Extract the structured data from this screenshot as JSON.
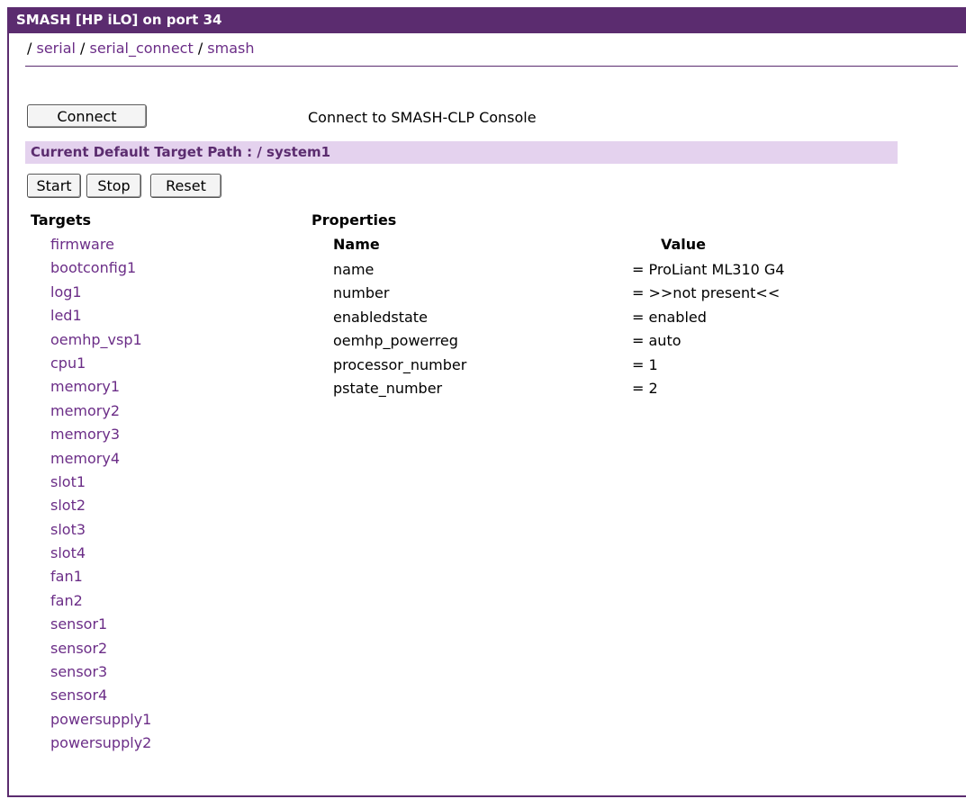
{
  "window": {
    "title": "SMASH [HP iLO] on port 34"
  },
  "breadcrumb": {
    "lead_sep": "/",
    "items": [
      "serial",
      "serial_connect",
      "smash"
    ],
    "sep": " / "
  },
  "connect": {
    "button_label": "Connect",
    "description": "Connect to SMASH-CLP Console"
  },
  "target_path": {
    "text": "Current Default Target Path : / system1"
  },
  "actions": {
    "start": "Start",
    "stop": "Stop",
    "reset": "Reset"
  },
  "targets": {
    "heading": "Targets",
    "items": [
      "firmware",
      "bootconfig1",
      "log1",
      "led1",
      "oemhp_vsp1",
      "cpu1",
      "memory1",
      "memory2",
      "memory3",
      "memory4",
      "slot1",
      "slot2",
      "slot3",
      "slot4",
      "fan1",
      "fan2",
      "sensor1",
      "sensor2",
      "sensor3",
      "sensor4",
      "powersupply1",
      "powersupply2"
    ]
  },
  "properties": {
    "heading": "Properties",
    "name_header": "Name",
    "value_header": "Value",
    "rows": [
      {
        "name": "name",
        "value": "= ProLiant ML310 G4"
      },
      {
        "name": "number",
        "value": "= >>not present<<"
      },
      {
        "name": "enabledstate",
        "value": "= enabled"
      },
      {
        "name": "oemhp_powerreg",
        "value": "= auto"
      },
      {
        "name": "processor_number",
        "value": "= 1"
      },
      {
        "name": "pstate_number",
        "value": "= 2"
      }
    ]
  },
  "colors": {
    "accent": "#5b2c6f",
    "link": "#6b2d87",
    "path_bg": "#e4d2ee"
  }
}
